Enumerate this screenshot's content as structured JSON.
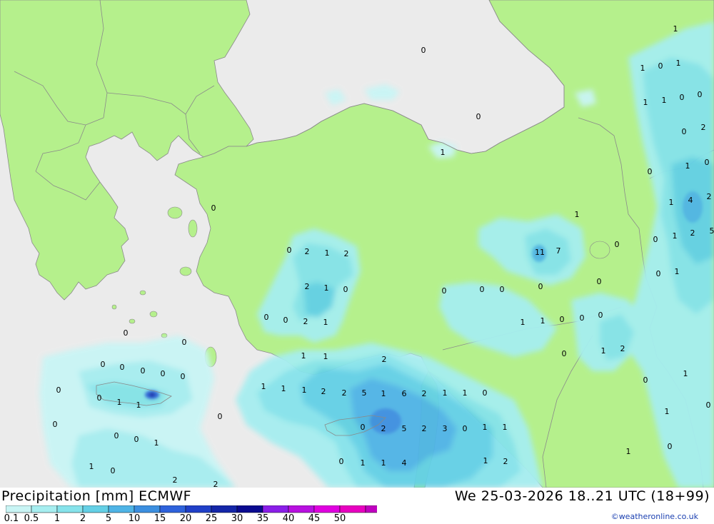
{
  "map": {
    "value_labels": [
      {
        "text": "0",
        "key": "a"
      },
      {
        "text": "0",
        "key": "b"
      },
      {
        "text": "1",
        "key": "c"
      },
      {
        "text": "0",
        "key": "d"
      },
      {
        "text": "1",
        "key": "e"
      },
      {
        "text": "1",
        "key": "f"
      },
      {
        "text": "0",
        "key": "g"
      },
      {
        "text": "1",
        "key": "h"
      },
      {
        "text": "0",
        "key": "i"
      },
      {
        "text": "2",
        "key": "j"
      },
      {
        "text": "1",
        "key": "k"
      },
      {
        "text": "1",
        "key": "l"
      },
      {
        "text": "0",
        "key": "m"
      },
      {
        "text": "0",
        "key": "n"
      },
      {
        "text": "1",
        "key": "o"
      },
      {
        "text": "0",
        "key": "p"
      },
      {
        "text": "1",
        "key": "q"
      },
      {
        "text": "4",
        "key": "r"
      },
      {
        "text": "2",
        "key": "s"
      },
      {
        "text": "0",
        "key": "t"
      },
      {
        "text": "1",
        "key": "u"
      },
      {
        "text": "2",
        "key": "v"
      },
      {
        "text": "5",
        "key": "w"
      },
      {
        "text": "0",
        "key": "x"
      },
      {
        "text": "1",
        "key": "y"
      },
      {
        "text": "0",
        "key": "z"
      },
      {
        "text": "0",
        "key": "aa"
      },
      {
        "text": "2",
        "key": "ab"
      },
      {
        "text": "1",
        "key": "ac"
      },
      {
        "text": "2",
        "key": "ad"
      },
      {
        "text": "1",
        "key": "ae"
      },
      {
        "text": "11",
        "key": "af"
      },
      {
        "text": "7",
        "key": "ag"
      },
      {
        "text": "2",
        "key": "ah"
      },
      {
        "text": "1",
        "key": "ai"
      },
      {
        "text": "0",
        "key": "aj"
      },
      {
        "text": "0",
        "key": "ak"
      },
      {
        "text": "0",
        "key": "al"
      },
      {
        "text": "0",
        "key": "am"
      },
      {
        "text": "0",
        "key": "an"
      },
      {
        "text": "0",
        "key": "ao"
      },
      {
        "text": "0",
        "key": "ap"
      },
      {
        "text": "2",
        "key": "aq"
      },
      {
        "text": "1",
        "key": "ar"
      },
      {
        "text": "1",
        "key": "as"
      },
      {
        "text": "1",
        "key": "at"
      },
      {
        "text": "0",
        "key": "au"
      },
      {
        "text": "0",
        "key": "av"
      },
      {
        "text": "0",
        "key": "aw"
      },
      {
        "text": "0",
        "key": "ax"
      },
      {
        "text": "1",
        "key": "ay"
      },
      {
        "text": "2",
        "key": "az"
      },
      {
        "text": "0",
        "key": "ba"
      },
      {
        "text": "1",
        "key": "bb"
      },
      {
        "text": "1",
        "key": "bc"
      },
      {
        "text": "2",
        "key": "bd"
      },
      {
        "text": "1",
        "key": "be"
      },
      {
        "text": "1",
        "key": "bf"
      },
      {
        "text": "1",
        "key": "bg"
      },
      {
        "text": "2",
        "key": "bh"
      },
      {
        "text": "2",
        "key": "bi"
      },
      {
        "text": "5",
        "key": "bj"
      },
      {
        "text": "1",
        "key": "bk"
      },
      {
        "text": "6",
        "key": "bl"
      },
      {
        "text": "2",
        "key": "bm"
      },
      {
        "text": "1",
        "key": "bn"
      },
      {
        "text": "1",
        "key": "bo"
      },
      {
        "text": "0",
        "key": "bp"
      },
      {
        "text": "0",
        "key": "bq"
      },
      {
        "text": "1",
        "key": "br"
      },
      {
        "text": "0",
        "key": "bs"
      },
      {
        "text": "1",
        "key": "bt"
      },
      {
        "text": "0",
        "key": "bu"
      },
      {
        "text": "0",
        "key": "bv"
      },
      {
        "text": "0",
        "key": "bw"
      },
      {
        "text": "0",
        "key": "bx"
      },
      {
        "text": "0",
        "key": "by"
      },
      {
        "text": "0",
        "key": "bz"
      },
      {
        "text": "1",
        "key": "ca"
      },
      {
        "text": "1",
        "key": "cb"
      },
      {
        "text": "0",
        "key": "cc"
      },
      {
        "text": "0",
        "key": "cd"
      },
      {
        "text": "0",
        "key": "ce"
      },
      {
        "text": "0",
        "key": "cf"
      },
      {
        "text": "1",
        "key": "cg"
      },
      {
        "text": "0",
        "key": "ch"
      },
      {
        "text": "0",
        "key": "ci"
      },
      {
        "text": "2",
        "key": "cj"
      },
      {
        "text": "5",
        "key": "ck"
      },
      {
        "text": "2",
        "key": "cl"
      },
      {
        "text": "3",
        "key": "cm"
      },
      {
        "text": "0",
        "key": "cn"
      },
      {
        "text": "1",
        "key": "co"
      },
      {
        "text": "1",
        "key": "cp"
      },
      {
        "text": "1",
        "key": "cq"
      },
      {
        "text": "0",
        "key": "cr"
      },
      {
        "text": "0",
        "key": "cs"
      },
      {
        "text": "0",
        "key": "ct"
      },
      {
        "text": "0",
        "key": "cu"
      },
      {
        "text": "2",
        "key": "cv"
      },
      {
        "text": "2",
        "key": "cw"
      },
      {
        "text": "0",
        "key": "cx"
      },
      {
        "text": "1",
        "key": "cy"
      },
      {
        "text": "1",
        "key": "cz"
      },
      {
        "text": "4",
        "key": "da"
      },
      {
        "text": "1",
        "key": "db"
      },
      {
        "text": "2",
        "key": "dc"
      },
      {
        "text": "1",
        "key": "dd"
      },
      {
        "text": "0",
        "key": "de"
      }
    ]
  },
  "footer": {
    "title": "Precipitation [mm] ECMWF",
    "datetime": "We 25-03-2026 18..21 UTC (18+99)",
    "credit": "©weatheronline.co.uk"
  },
  "legend": {
    "ticks": [
      "0.1",
      "0.5",
      "1",
      "2",
      "5",
      "10",
      "15",
      "20",
      "25",
      "30",
      "35",
      "40",
      "45",
      "50"
    ],
    "colors": [
      "#c9f5f5",
      "#a6eef0",
      "#86e3eb",
      "#64d0e6",
      "#4fb4e6",
      "#3c8fe0",
      "#2e62dc",
      "#2040c8",
      "#1426a8",
      "#0a0a90",
      "#8a1ee8",
      "#b810e0",
      "#e000e0",
      "#e800c0",
      "#c000c0"
    ]
  },
  "colors": {
    "land": "#b5f08c",
    "sea": "#ebebeb",
    "border": "#8a8a8a"
  }
}
